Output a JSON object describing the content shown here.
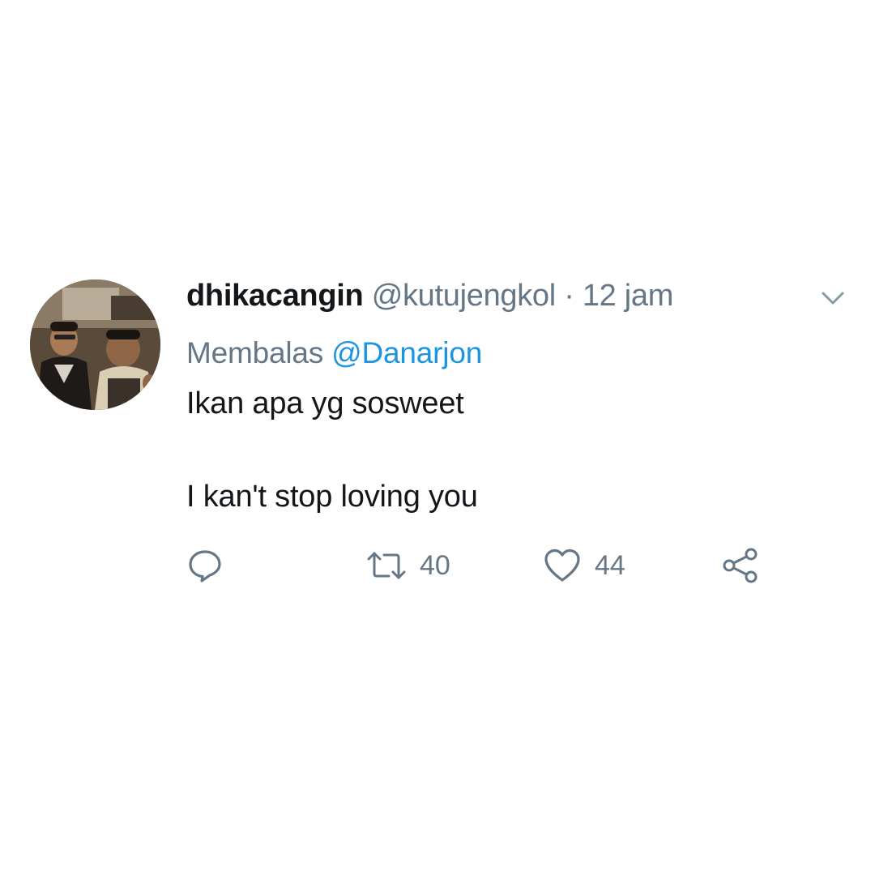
{
  "tweet": {
    "display_name": "dhikacangin",
    "handle": "@kutujengkol",
    "separator": "·",
    "time": "12 jam",
    "reply_prefix": "Membalas",
    "reply_target": "@Danarjon",
    "text_lines": [
      "Ikan apa yg sosweet",
      "I kan't stop loving you"
    ],
    "actions": {
      "reply_icon": "reply-icon",
      "retweet_icon": "retweet-icon",
      "retweet_count": "40",
      "like_icon": "heart-icon",
      "like_count": "44",
      "share_icon": "share-icon"
    },
    "menu_icon": "chevron-down-icon"
  },
  "colors": {
    "background": "#ffffff",
    "text_primary": "#14171a",
    "text_secondary": "#657786",
    "link": "#1b95e0"
  }
}
